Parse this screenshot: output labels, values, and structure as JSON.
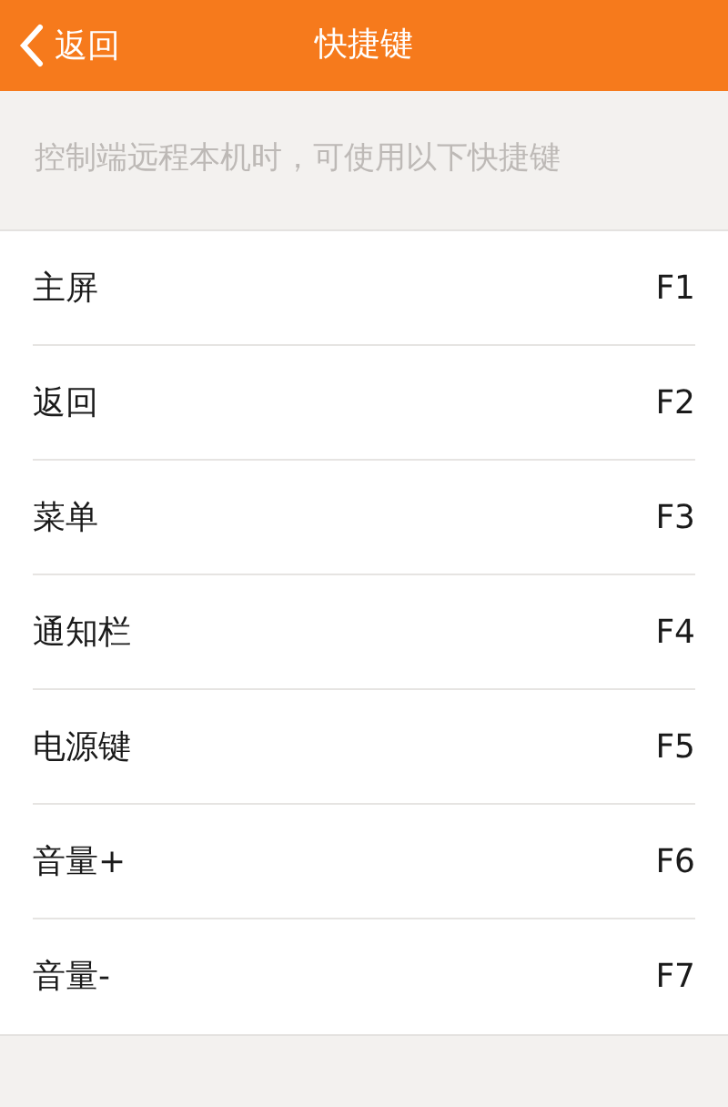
{
  "header": {
    "back_label": "返回",
    "title": "快捷键"
  },
  "hint": "控制端远程本机时，可使用以下快捷键",
  "shortcuts": [
    {
      "name": "主屏",
      "key": "F1"
    },
    {
      "name": "返回",
      "key": "F2"
    },
    {
      "name": "菜单",
      "key": "F3"
    },
    {
      "name": "通知栏",
      "key": "F4"
    },
    {
      "name": "电源键",
      "key": "F5"
    },
    {
      "name": "音量+",
      "key": "F6"
    },
    {
      "name": "音量-",
      "key": "F7"
    }
  ]
}
